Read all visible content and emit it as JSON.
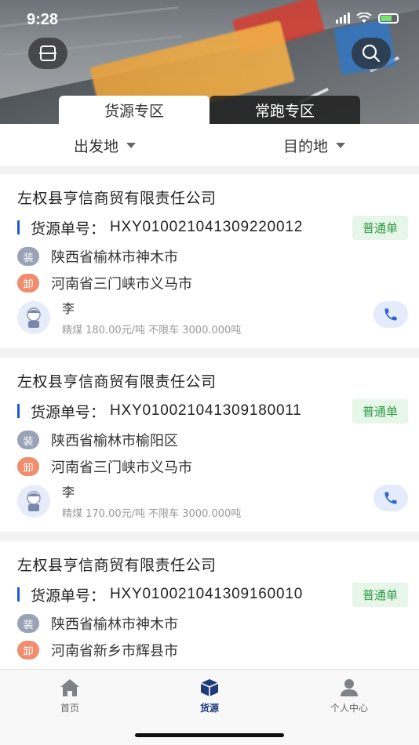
{
  "status": {
    "time": "9:28"
  },
  "header": {
    "tabs": [
      {
        "label": "货源专区",
        "active": true
      },
      {
        "label": "常跑专区",
        "active": false
      }
    ],
    "scan_icon": "scan-icon",
    "search_icon": "search-icon"
  },
  "filters": {
    "origin": "出发地",
    "destination": "目的地"
  },
  "cards": [
    {
      "company": "左权县亨信商贸有限责任公司",
      "order_label": "货源单号：",
      "order_no": "HXY010021041309220012",
      "badge": "普通单",
      "load_tag": "装",
      "load_addr": "陕西省榆林市神木市",
      "unload_tag": "卸",
      "unload_addr": "河南省三门峡市义马市",
      "person": "李",
      "detail": "精煤 180.00元/吨 不限车 3000.000吨"
    },
    {
      "company": "左权县亨信商贸有限责任公司",
      "order_label": "货源单号：",
      "order_no": "HXY010021041309180011",
      "badge": "普通单",
      "load_tag": "装",
      "load_addr": "陕西省榆林市榆阳区",
      "unload_tag": "卸",
      "unload_addr": "河南省三门峡市义马市",
      "person": "李",
      "detail": "精煤 170.00元/吨 不限车 3000.000吨"
    },
    {
      "company": "左权县亨信商贸有限责任公司",
      "order_label": "货源单号：",
      "order_no": "HXY010021041309160010",
      "badge": "普通单",
      "load_tag": "装",
      "load_addr": "陕西省榆林市神木市",
      "unload_tag": "卸",
      "unload_addr": "河南省新乡市辉县市"
    }
  ],
  "nav": [
    {
      "label": "首页",
      "icon": "home-icon",
      "active": false
    },
    {
      "label": "货源",
      "icon": "cube-icon",
      "active": true
    },
    {
      "label": "个人中心",
      "icon": "user-icon",
      "active": false
    }
  ],
  "colors": {
    "accent": "#1e5ad6",
    "badge_green": "#2f9b45",
    "load_tag": "#9aa2b5",
    "unload_tag": "#ef8d6e",
    "nav_active": "#1f3a7a"
  }
}
